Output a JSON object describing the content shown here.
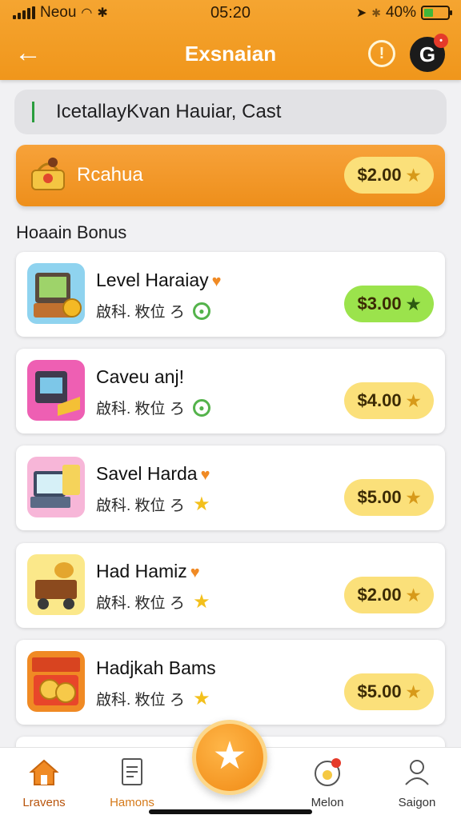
{
  "status_bar": {
    "carrier": "Neou",
    "time": "05:20",
    "battery_text": "40%",
    "battery_level": 0.4
  },
  "header": {
    "title": "Exsnaian"
  },
  "search": {
    "value": "IcetallayKvan Hauiar, Cast"
  },
  "featured": {
    "label": "Rcahua",
    "price": "$2.00"
  },
  "section_title": "Hoaain Bonus",
  "items": [
    {
      "title": "Level Haraiay",
      "meta": "啟科. 敉位 ろ",
      "price": "$3.00",
      "badge": "leaf",
      "accent": "#9be34c"
    },
    {
      "title": "Caveu anj!",
      "meta": "啟科. 敉位 ろ",
      "price": "$4.00",
      "badge": "leaf",
      "accent": "#fbe07a"
    },
    {
      "title": "Savel Harda",
      "meta": "啟科. 敉位 ろ",
      "price": "$5.00",
      "badge": "star",
      "accent": "#fbe07a"
    },
    {
      "title": "Had Hamiz",
      "meta": "啟科. 敉位 ろ",
      "price": "$2.00",
      "badge": "star",
      "accent": "#fbe07a"
    },
    {
      "title": "Hadjkah Bams",
      "meta": "啟科. 敉位 ろ",
      "price": "$5.00",
      "badge": "star",
      "accent": "#fbe07a"
    }
  ],
  "bottom_nav": {
    "tabs": [
      {
        "label": "Lravens",
        "icon": "home-icon"
      },
      {
        "label": "Hamons",
        "icon": "document-icon"
      },
      {
        "label": "Melon",
        "icon": "camera-icon"
      },
      {
        "label": "Saigon",
        "icon": "user-icon"
      }
    ]
  },
  "colors": {
    "brand_orange": "#f0961b",
    "price_yellow": "#fbe07a",
    "price_green": "#9be34c"
  }
}
